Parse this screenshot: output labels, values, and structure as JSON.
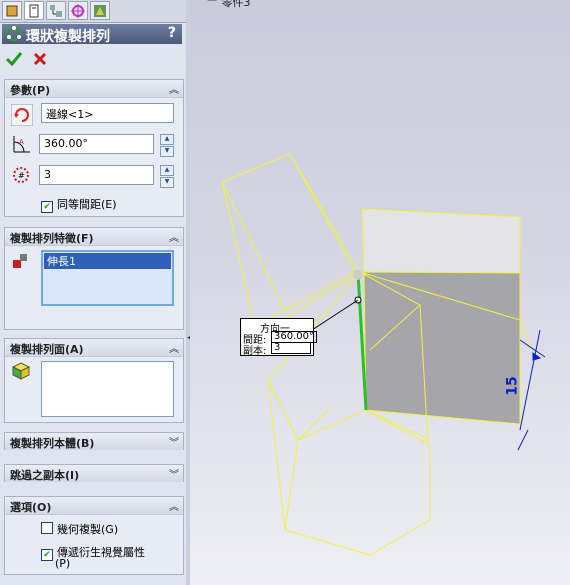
{
  "feature_manager": {
    "tabs": [
      "feature-tree-icon",
      "property-manager-icon",
      "configuration-icon",
      "dim-xpert-icon",
      "display-manager-icon"
    ],
    "title": "環狀複製排列",
    "help_label": "?",
    "ok_icon": "checkmark-icon",
    "cancel_icon": "close-icon"
  },
  "params": {
    "header": "參數(P)",
    "axis_value": "邊線<1>",
    "angle_value": "360.00°",
    "instances_value": "3",
    "equal_spacing_label": "同等間距(E)",
    "equal_spacing_checked": true
  },
  "features": {
    "header": "複製排列特徵(F)",
    "items": [
      "伸長1"
    ]
  },
  "faces": {
    "header": "複製排列面(A)",
    "items": []
  },
  "bodies": {
    "header": "複製排列本體(B)"
  },
  "skip": {
    "header": "跳過之副本(I)"
  },
  "options": {
    "header": "選項(O)",
    "geometry_pattern_label": "幾何複製(G)",
    "geometry_pattern_checked": false,
    "propagate_visual_label": "傳遞衍生視覺屬性",
    "propagate_visual_label2": "(P)",
    "propagate_visual_checked": true
  },
  "viewport": {
    "tree_label": "零件3",
    "callout": {
      "title": "方向一",
      "spacing_label": "間距:",
      "spacing_value": "360.00°",
      "copies_label": "副本:",
      "copies_value": "3"
    },
    "dimension_value": "15"
  },
  "colors": {
    "wireframe": "#f2f23c",
    "edge_selected": "#27c227",
    "dimension": "#0a20c8",
    "face_gray": "#a9a9a9"
  }
}
